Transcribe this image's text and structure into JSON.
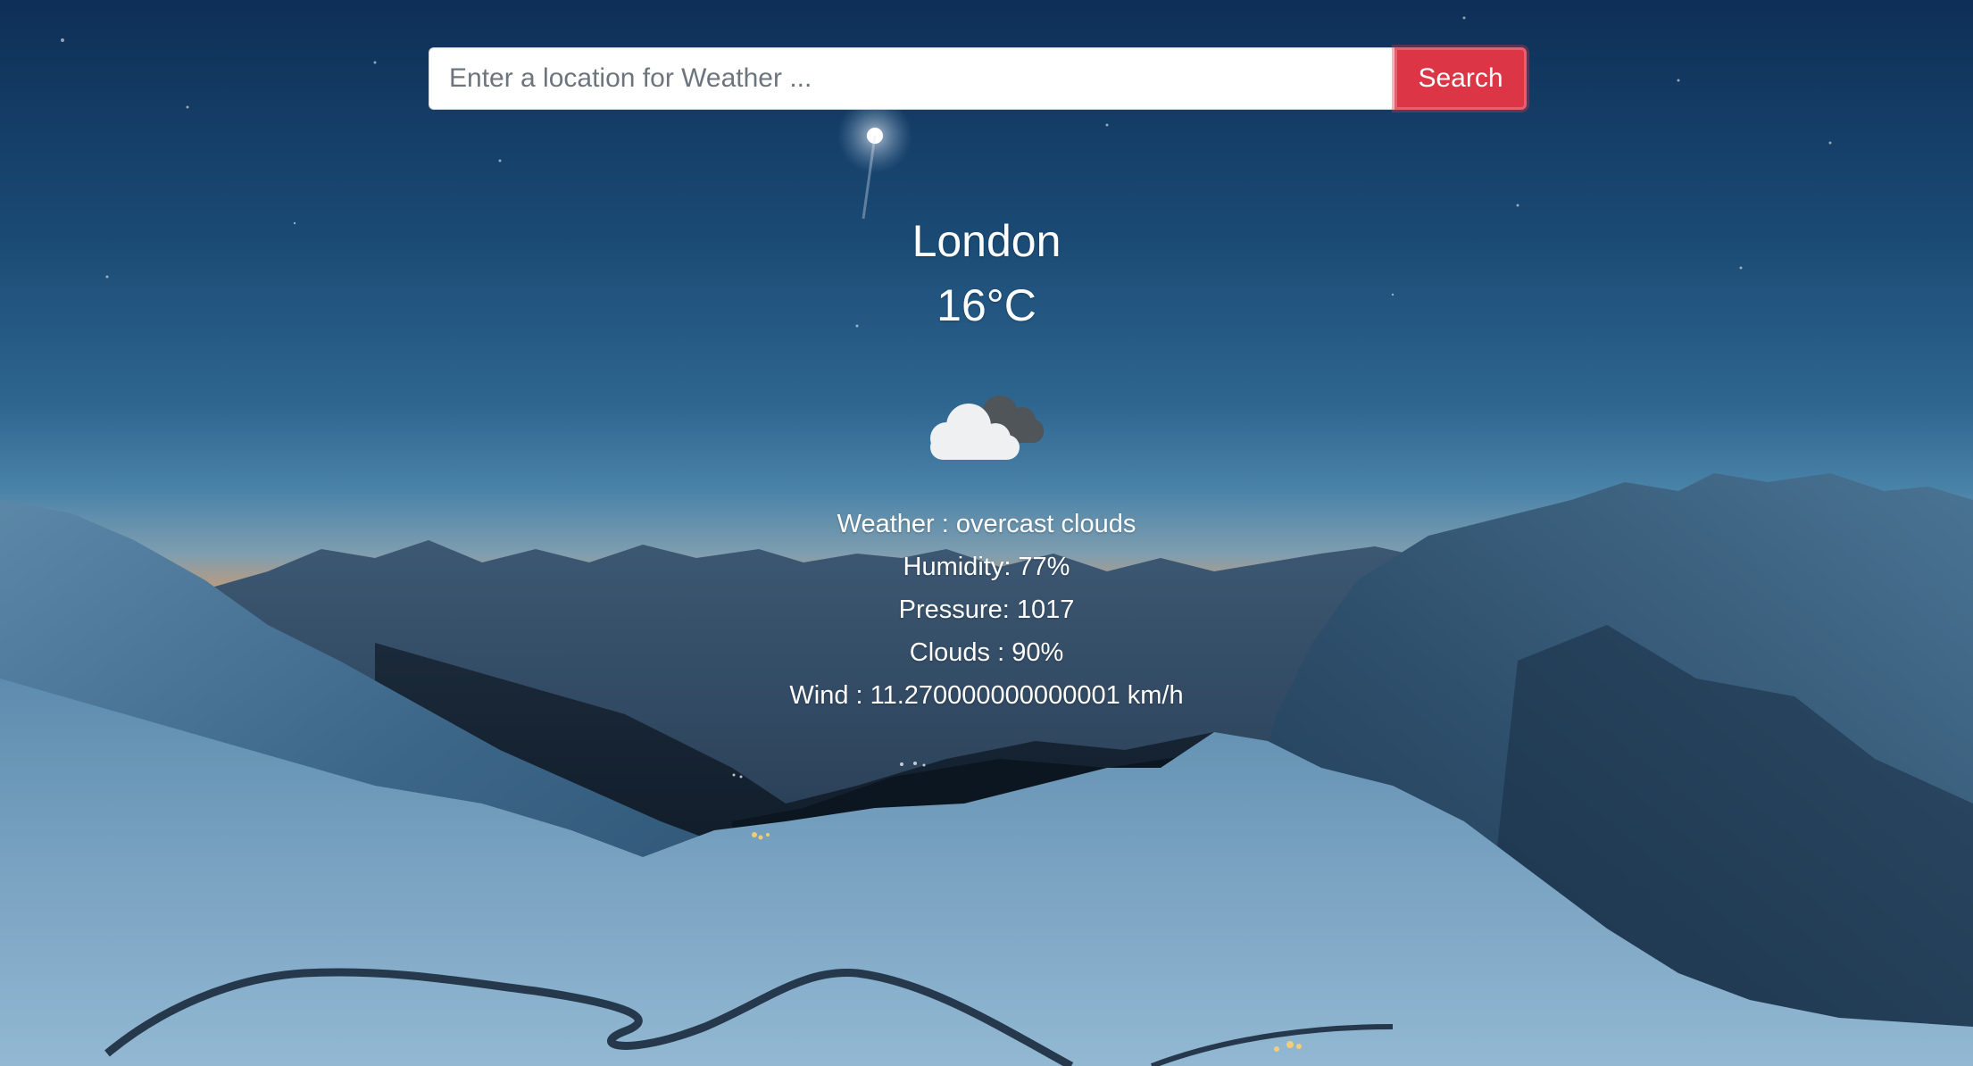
{
  "search": {
    "placeholder": "Enter a location for Weather ...",
    "value": "",
    "button_label": "Search"
  },
  "weather": {
    "city": "London",
    "temperature": "16°C",
    "icon": "overcast-clouds-icon",
    "description": "Weather : overcast clouds",
    "humidity": "Humidity: 77%",
    "pressure": "Pressure: 1017",
    "clouds": "Clouds : 90%",
    "wind": "Wind : 11.270000000000001 km/h"
  },
  "colors": {
    "search_button": "#dc3545",
    "sky_top": "#0d2f55",
    "sky_horizon": "#e29b5c",
    "text": "#ffffff"
  }
}
